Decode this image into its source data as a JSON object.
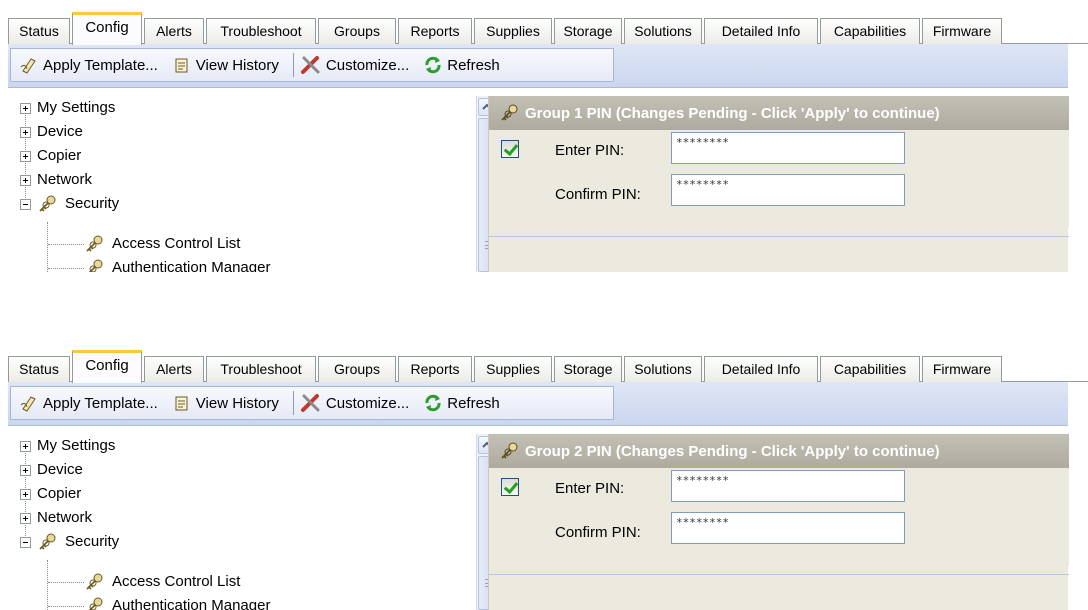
{
  "panels": [
    {
      "tabs": [
        "Status",
        "Config",
        "Alerts",
        "Troubleshoot",
        "Groups",
        "Reports",
        "Supplies",
        "Storage",
        "Solutions",
        "Detailed Info",
        "Capabilities",
        "Firmware"
      ],
      "active_tab": "Config",
      "toolbar": {
        "apply_template": "Apply Template...",
        "view_history": "View History",
        "customize": "Customize...",
        "refresh": "Refresh"
      },
      "tree": {
        "items": [
          "My Settings",
          "Device",
          "Copier",
          "Network",
          "Security"
        ],
        "children": [
          "Access Control List",
          "Authentication Manager"
        ]
      },
      "group": {
        "header": "Group 1 PIN  (Changes Pending - Click 'Apply' to continue)",
        "enter_pin_label": "Enter PIN:",
        "enter_pin_value": "********",
        "confirm_pin_label": "Confirm PIN:",
        "confirm_pin_value": "********",
        "checked": true
      }
    },
    {
      "tabs": [
        "Status",
        "Config",
        "Alerts",
        "Troubleshoot",
        "Groups",
        "Reports",
        "Supplies",
        "Storage",
        "Solutions",
        "Detailed Info",
        "Capabilities",
        "Firmware"
      ],
      "active_tab": "Config",
      "toolbar": {
        "apply_template": "Apply Template...",
        "view_history": "View History",
        "customize": "Customize...",
        "refresh": "Refresh"
      },
      "tree": {
        "items": [
          "My Settings",
          "Device",
          "Copier",
          "Network",
          "Security"
        ],
        "children": [
          "Access Control List",
          "Authentication Manager"
        ]
      },
      "group": {
        "header": "Group 2 PIN  (Changes Pending - Click 'Apply' to continue)",
        "enter_pin_label": "Enter PIN:",
        "enter_pin_value": "********",
        "confirm_pin_label": "Confirm PIN:",
        "confirm_pin_value": "********",
        "checked": true
      }
    }
  ],
  "colors": {
    "active_tab_accent": "#ffc83c",
    "toolbar_bg": "#dfe6f5",
    "group_header_bg": "#b8b4a8",
    "pane_bg": "#eceade",
    "check_green": "#21a121"
  },
  "icons": {
    "apply_template": "template-icon",
    "view_history": "history-icon",
    "customize": "customize-tools-icon",
    "refresh": "refresh-icon",
    "security": "security-keys-icon",
    "group": "security-keys-icon"
  }
}
